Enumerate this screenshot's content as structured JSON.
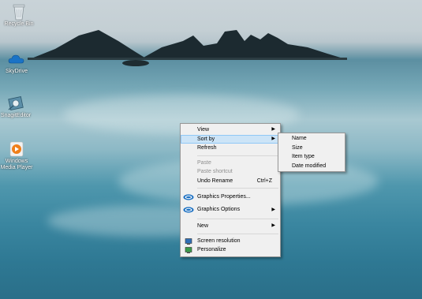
{
  "desktop_icons": [
    {
      "label": "Recycle Bin",
      "icon": "recycle-bin-icon"
    },
    {
      "label": "SkyDrive",
      "icon": "skydrive-icon"
    },
    {
      "label": "SnagitEditor",
      "icon": "snagit-icon"
    },
    {
      "label_line1": "Windows",
      "label_line2": "Media Player",
      "icon": "media-player-icon"
    }
  ],
  "context_menu": {
    "view": "View",
    "sort_by": "Sort by",
    "refresh": "Refresh",
    "paste": "Paste",
    "paste_shortcut": "Paste shortcut",
    "undo_rename": "Undo Rename",
    "undo_shortcut": "Ctrl+Z",
    "graphics_properties": "Graphics Properties...",
    "graphics_options": "Graphics Options",
    "new": "New",
    "screen_resolution": "Screen resolution",
    "personalize": "Personalize"
  },
  "sort_submenu": {
    "name": "Name",
    "size": "Size",
    "item_type": "Item type",
    "date_modified": "Date modified"
  },
  "colors": {
    "menu_bg": "#f0f0f0",
    "highlight": "#cce4f7",
    "disabled_text": "#8e8e8e"
  }
}
